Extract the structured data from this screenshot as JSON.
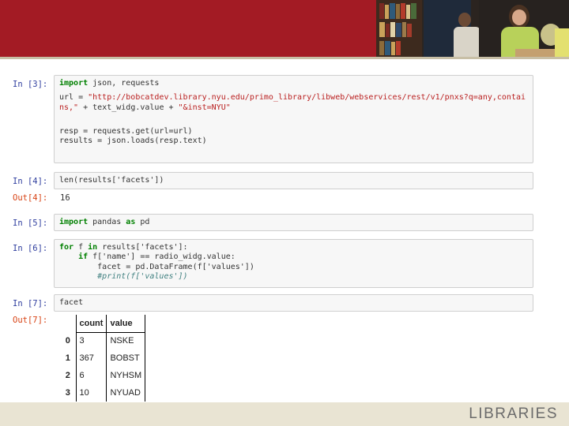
{
  "header": {
    "accent_color": "#a31b24",
    "photo": "library-students-photo"
  },
  "cells": {
    "c3": {
      "prompt": "In [3]:",
      "kw1": "import",
      "code1": " json, requests",
      "code2a": "url = ",
      "code2b": "\"http://bobcatdev.library.nyu.edu/primo_library/libweb/webservices/rest/v1/pnxs?q=any,contai",
      "code3a": "ns,\"",
      "code3b": " + text_widg.value + ",
      "code3c": "\"&inst=NYU\"",
      "code4": "resp = requests.get(url=url)",
      "code5": "results = json.loads(resp.text)"
    },
    "c4": {
      "prompt": "In [4]:",
      "code": "len(results['facets'])",
      "out_prompt": "Out[4]:",
      "output": "16"
    },
    "c5": {
      "prompt": "In [5]:",
      "kw1": "import",
      "mid": " pandas ",
      "kw2": "as",
      "end": " pd"
    },
    "c6": {
      "prompt": "In [6]:",
      "l1_kw": "for",
      "l1_mid": " f ",
      "l1_kw2": "in",
      "l1_end": " results['facets']:",
      "l2_kw": "    if",
      "l2_end": " f['name'] == radio_widg.value:",
      "l3": "        facet = pd.DataFrame(f['values'])",
      "l4": "        #print(f['values'])"
    },
    "c7": {
      "prompt": "In [7]:",
      "code": "facet",
      "out_prompt": "Out[7]:"
    }
  },
  "dataframe": {
    "columns": [
      "",
      "count",
      "value"
    ],
    "rows": [
      {
        "index": "0",
        "count": "3",
        "value": "NSKE"
      },
      {
        "index": "1",
        "count": "367",
        "value": "BOBST"
      },
      {
        "index": "2",
        "count": "6",
        "value": "NYHSM"
      },
      {
        "index": "3",
        "count": "10",
        "value": "NYUAD"
      }
    ]
  },
  "footer": {
    "logo_text": "LIBRARIES"
  }
}
